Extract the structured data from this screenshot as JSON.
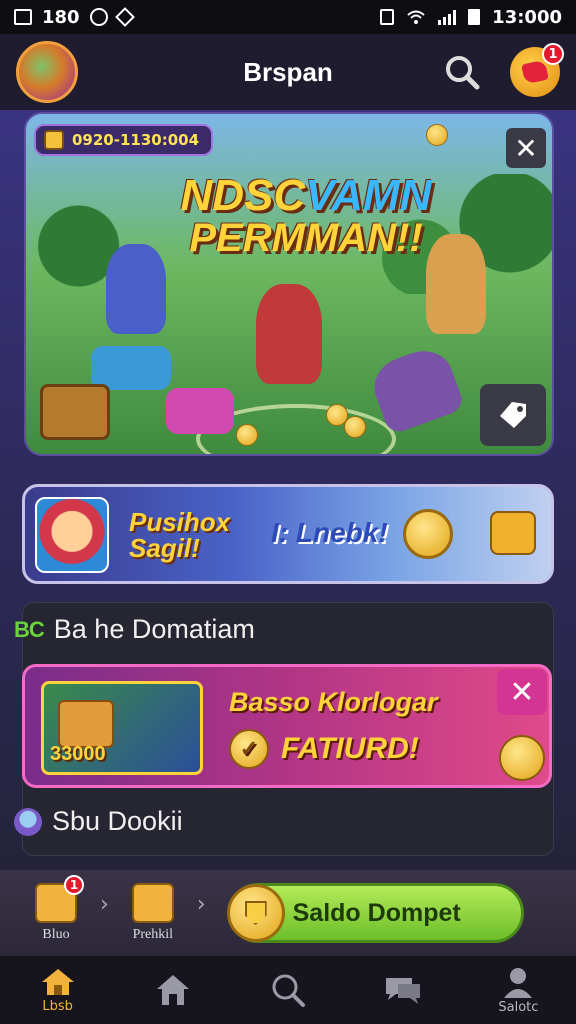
{
  "status_bar": {
    "left_text": "180",
    "time": "13:000"
  },
  "header": {
    "title": "Brspan"
  },
  "notifications": {
    "badge": "1"
  },
  "hero": {
    "date": "0920-1130:004",
    "title_line1_a": "NDSC",
    "title_line1_b": "VAMN",
    "title_line2": "PERMMAN!!"
  },
  "promo": {
    "text1": "Pusihox Sagil!",
    "text2": "I: Lnebk!"
  },
  "list": {
    "row1_icon": "BC",
    "row1_label": "Ba he Domatiam",
    "row2_label": "Sbu Dookii"
  },
  "event": {
    "price": "33000",
    "title": "Basso Klorlogar",
    "subtitle": "FATIURD!"
  },
  "actions": {
    "item1_label": "Bluo",
    "item1_badge": "1",
    "item2_label": "Prehkil",
    "wallet_label": "Saldo Dompet"
  },
  "nav": {
    "items": [
      {
        "label": "Lbsb",
        "icon": "home-icon"
      },
      {
        "label": "",
        "icon": "home-icon"
      },
      {
        "label": "",
        "icon": "search-icon"
      },
      {
        "label": "",
        "icon": "chat-icon"
      },
      {
        "label": "Salotc",
        "icon": "profile-icon"
      }
    ]
  },
  "colors": {
    "accent": "#f2b33c",
    "wallet_green": "#6bbf2a",
    "event_pink": "#e04a8a",
    "badge_red": "#e5192d"
  }
}
